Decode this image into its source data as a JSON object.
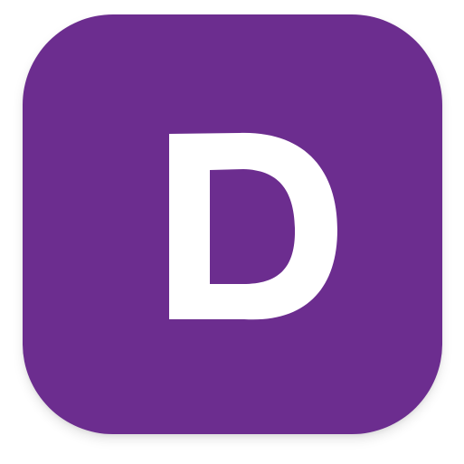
{
  "app_icon": {
    "letter": "D",
    "background_color": "#6c2d8f",
    "letter_color": "#ffffff"
  }
}
